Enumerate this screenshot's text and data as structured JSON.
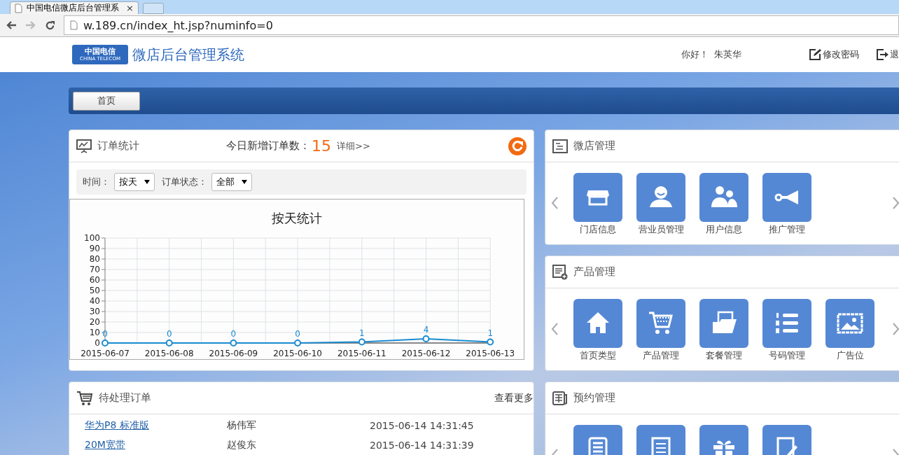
{
  "browser": {
    "tab": {
      "title": "中国电信微店后台管理系",
      "close": "×"
    },
    "url": "w.189.cn/index_ht.jsp?numinfo=0"
  },
  "header": {
    "logo_cn": "中国电信",
    "logo_en": "CHINA TELECOM",
    "title": "微店后台管理系统",
    "greeting": "你好！",
    "user": "朱英华",
    "actions": [
      {
        "kind": "edit",
        "label": "修改密码"
      },
      {
        "kind": "exit",
        "label": "退"
      }
    ]
  },
  "nav": {
    "tabs": [
      {
        "label": "首页",
        "selected": true
      }
    ]
  },
  "order_stats": {
    "title": "订单统计",
    "today_label": "今日新增订单数：",
    "today_count": "15",
    "detail_link": "详细>>",
    "filters": [
      {
        "label": "时间：",
        "value": "按天"
      },
      {
        "label": "订单状态：",
        "value": "全部"
      }
    ],
    "chart_data": {
      "type": "line",
      "title": "按天统计",
      "categories": [
        "2015-06-07",
        "2015-06-08",
        "2015-06-09",
        "2015-06-10",
        "2015-06-11",
        "2015-06-12",
        "2015-06-13"
      ],
      "series": [
        {
          "color": "#1a8bd0",
          "marker": true,
          "values": [
            0,
            0,
            0,
            0,
            1,
            4,
            1
          ]
        }
      ],
      "grid": true,
      "ylim": [
        0,
        100
      ],
      "yticks": [
        0,
        10,
        20,
        30,
        40,
        50,
        60,
        70,
        80,
        90,
        100
      ],
      "data_labels": true
    }
  },
  "pending_orders": {
    "title": "待处理订单",
    "more_link": "查看更多",
    "rows": [
      {
        "product": "华为P8 标准版",
        "customer": "杨伟军",
        "time": "2015-06-14 14:31:45"
      },
      {
        "product": "20M宽带",
        "customer": "赵俊东",
        "time": "2015-06-14 14:31:39"
      }
    ]
  },
  "panels": [
    {
      "kind": "shop",
      "title": "微店管理",
      "tiles": [
        {
          "kind": "store",
          "label": "门店信息"
        },
        {
          "kind": "person",
          "label": "营业员管理"
        },
        {
          "kind": "people",
          "label": "用户信息"
        },
        {
          "kind": "horn",
          "label": "推广管理"
        }
      ]
    },
    {
      "kind": "product",
      "title": "产品管理",
      "tiles": [
        {
          "kind": "home",
          "label": "首页类型"
        },
        {
          "kind": "cart",
          "label": "产品管理"
        },
        {
          "kind": "folder",
          "label": "套餐管理"
        },
        {
          "kind": "numbers",
          "label": "号码管理"
        },
        {
          "kind": "picture",
          "label": "广告位"
        }
      ]
    },
    {
      "kind": "booking",
      "title": "预约管理",
      "tiles": [
        {
          "kind": "table"
        },
        {
          "kind": "list"
        },
        {
          "kind": "gift"
        },
        {
          "kind": "pen"
        }
      ]
    }
  ]
}
